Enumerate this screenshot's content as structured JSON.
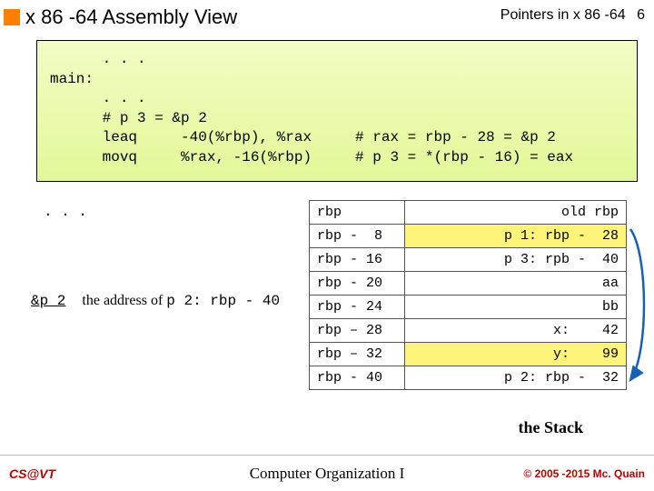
{
  "header": {
    "title": "x 86 -64 Assembly View",
    "topic": "Pointers in x 86 -64",
    "page": "6"
  },
  "code": "      . . .\nmain:\n      . . .\n      # p 3 = &p 2\n      leaq     -40(%rbp), %rax     # rax = rbp - 28 = &p 2\n      movq     %rax, -16(%rbp)     # p 3 = *(rbp - 16) = eax",
  "dots": ". . .",
  "p2": {
    "label": "&p 2",
    "prefix": "the address of ",
    "mono": "p 2: rbp -  40"
  },
  "stack_rows": [
    {
      "left": "rbp",
      "right": "old rbp",
      "hl": false
    },
    {
      "left": "rbp -  8",
      "right": "p 1: rbp -  28",
      "hl": true
    },
    {
      "left": "rbp - 16",
      "right": "p 3: rpb -  40",
      "hl": false
    },
    {
      "left": "rbp - 20",
      "right": "aa",
      "hl": false
    },
    {
      "left": "rbp - 24",
      "right": "bb",
      "hl": false
    },
    {
      "left": "rbp – 28",
      "right": "x:    42",
      "hl": false
    },
    {
      "left": "rbp – 32",
      "right": "y:    99",
      "hl": true
    },
    {
      "left": "rbp - 40",
      "right": "p 2: rbp -  32",
      "hl": false
    }
  ],
  "stack_caption": "the Stack",
  "footer": {
    "left": "CS@VT",
    "center": "Computer Organization I",
    "right": "© 2005 -2015 Mc. Quain"
  }
}
